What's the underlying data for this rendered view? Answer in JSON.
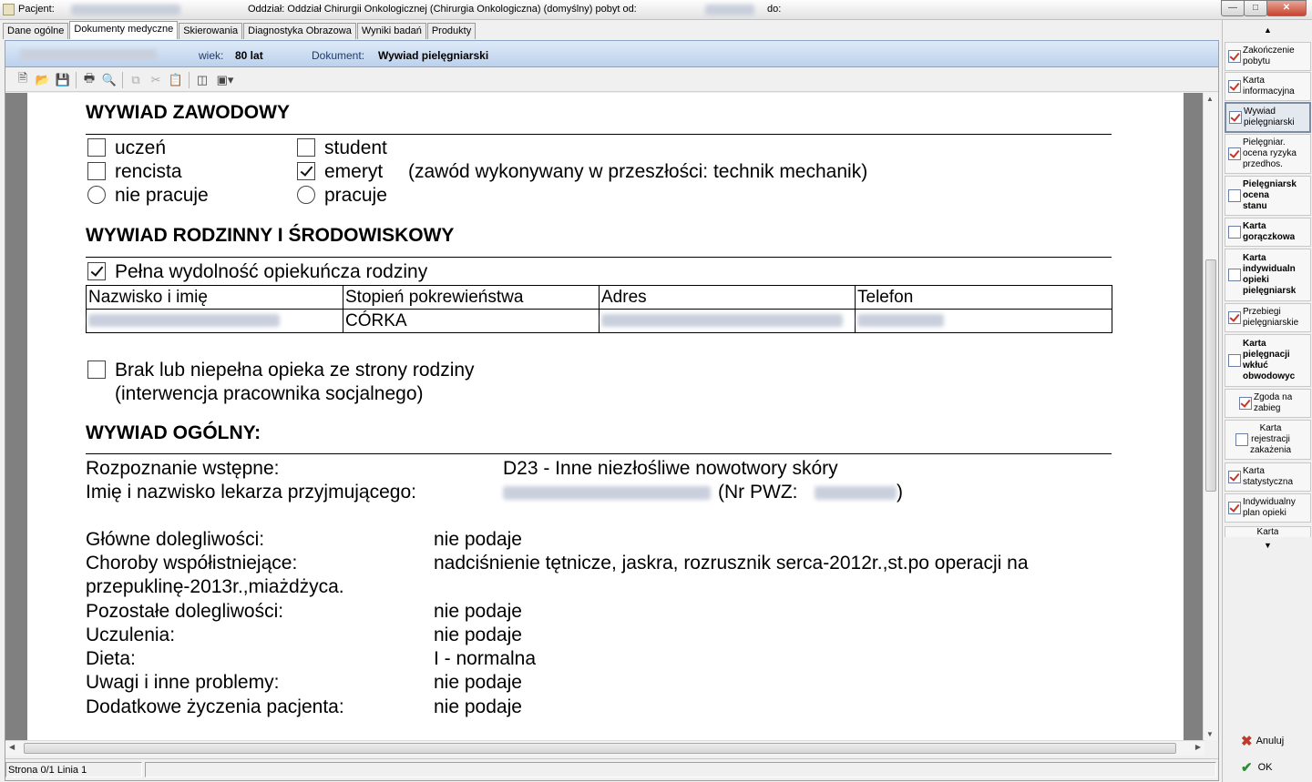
{
  "titlebar": {
    "patient_label": "Pacjent:",
    "department": "Oddział: Oddział Chirurgii Onkologicznej (Chirurgia Onkologiczna) (domyślny) pobyt od:",
    "to_label": "do:"
  },
  "tabs": [
    {
      "label": "Dane ogólne",
      "active": false
    },
    {
      "label": "Dokumenty medyczne",
      "active": true
    },
    {
      "label": "Skierowania",
      "active": false
    },
    {
      "label": "Diagnostyka Obrazowa",
      "active": false
    },
    {
      "label": "Wyniki badań",
      "active": false
    },
    {
      "label": "Produkty",
      "active": false
    }
  ],
  "infobar": {
    "age_label": "wiek:",
    "age_value": "80 lat",
    "document_label": "Dokument:",
    "document_value": "Wywiad pielęgniarski"
  },
  "document": {
    "occupational": {
      "title": "WYWIAD ZAWODOWY",
      "options": {
        "uczen": {
          "label": "uczeń",
          "checked": false
        },
        "student": {
          "label": "student",
          "checked": false
        },
        "rencista": {
          "label": "rencista",
          "checked": false
        },
        "emeryt": {
          "label": "emeryt",
          "checked": true
        },
        "nie_pracuje": {
          "label": "nie pracuje",
          "checked": false
        },
        "pracuje": {
          "label": "pracuje",
          "checked": false
        }
      },
      "past_occupation": "(zawód wykonywany w przeszłości: technik mechanik)"
    },
    "family": {
      "title": "WYWIAD RODZINNY I ŚRODOWISKOWY",
      "full_care_label": "Pełna wydolność opiekuńcza rodziny",
      "full_care_checked": true,
      "table_headers": [
        "Nazwisko i imię",
        "Stopień pokrewieństwa",
        "Adres",
        "Telefon"
      ],
      "row": {
        "relation": "CÓRKA"
      },
      "lack_label": "Brak lub niepełna opieka ze strony rodziny",
      "lack_note": "(interwencja pracownika socjalnego)",
      "lack_checked": false
    },
    "general": {
      "title": "WYWIAD OGÓLNY:",
      "diagnosis_label": "Rozpoznanie wstępne:",
      "diagnosis_value": "D23 - Inne niezłośliwe nowotwory skóry",
      "doctor_label": "Imię i nazwisko lekarza przyjmującego:",
      "pwz_label": "(Nr PWZ:",
      "pwz_close": ")",
      "complaints_label": "Główne dolegliwości:",
      "complaints_value": "nie podaje",
      "comorbid_label": "Choroby współistniejące:",
      "comorbid_value": "nadciśnienie tętnicze, jaskra, rozrusznik serca-2012r.,st.po operacji na",
      "comorbid_value_cont": "przepuklinę-2013r.,miażdżyca.",
      "other_label": "Pozostałe dolegliwości:",
      "other_value": "nie podaje",
      "allergy_label": "Uczulenia:",
      "allergy_value": "nie podaje",
      "diet_label": "Dieta:",
      "diet_value": "I - normalna",
      "notes_label": "Uwagi i inne problemy:",
      "notes_value": "nie podaje",
      "wishes_label": "Dodatkowe życzenia pacjenta:",
      "wishes_value": "nie podaje"
    }
  },
  "statusbar": {
    "position": "Strona 0/1 Linia 1"
  },
  "sidebar": {
    "items": [
      {
        "label": "Zakończenie\npobytu",
        "bold": false,
        "icon": "checklist-icon"
      },
      {
        "label": "Karta\ninformacyjna",
        "bold": false,
        "icon": "checklist-icon"
      },
      {
        "label": "Wywiad\npielęgniarski",
        "bold": false,
        "icon": "checklist-icon"
      },
      {
        "label": "Pielęgniar.\nocena ryzyka\nprzedhos.",
        "bold": false,
        "icon": "checklist-icon"
      },
      {
        "label": "Pielęgniarsk\nocena\nstanu",
        "bold": true,
        "icon": "document-icon"
      },
      {
        "label": "Karta\ngorączkowa",
        "bold": true,
        "icon": "document-icon"
      },
      {
        "label": "Karta\nindywidualn\nopieki\npielęgniarsk",
        "bold": true,
        "icon": "document-icon"
      },
      {
        "label": "Przebiegi\npielęgniarskie",
        "bold": false,
        "icon": "checklist-icon"
      },
      {
        "label": "Karta\npielęgnacji\nwkłuć\nobwodowyc",
        "bold": true,
        "icon": "document-icon"
      },
      {
        "label": "Zgoda na\nzabieg",
        "bold": false,
        "icon": "checklist-icon"
      },
      {
        "label": "Karta\nrejestracji\nzakażenia",
        "bold": false,
        "icon": "documents-icon"
      },
      {
        "label": "Karta\nstatystyczna",
        "bold": false,
        "icon": "checklist-icon"
      },
      {
        "label": "Indywidualny\nplan opieki",
        "bold": false,
        "icon": "checklist-icon"
      },
      {
        "label": "Karta",
        "bold": false,
        "icon": "checklist-icon"
      }
    ],
    "cancel_label": "Anuluj",
    "ok_label": "OK"
  }
}
